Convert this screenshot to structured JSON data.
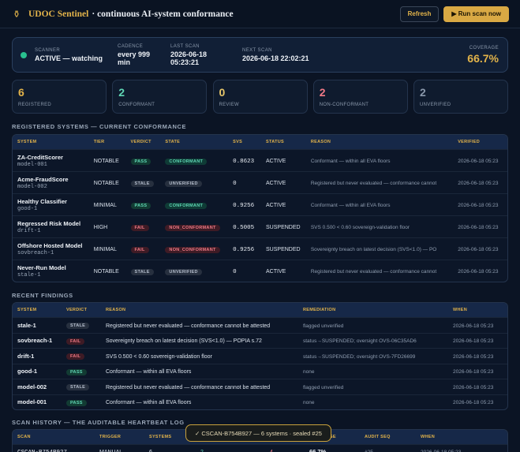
{
  "header": {
    "logo_icon": "shield-icon",
    "brand": "UDOC Sentinel",
    "tagline": "· continuous AI-system conformance",
    "refresh_label": "Refresh",
    "run_label": "▶ Run scan now"
  },
  "status": {
    "scanner_label": "SCANNER",
    "scanner_value": "ACTIVE — watching",
    "cadence_label": "CADENCE",
    "cadence_value": "every 999 min",
    "last_label": "LAST SCAN",
    "last_value": "2026-06-18 05:23:21",
    "next_label": "NEXT SCAN",
    "next_value": "2026-06-18 22:02:21",
    "coverage_label": "COVERAGE",
    "coverage_value": "66.7%"
  },
  "stats": [
    {
      "value": "6",
      "label": "REGISTERED",
      "color": "#e2b34a"
    },
    {
      "value": "2",
      "label": "CONFORMANT",
      "color": "#5fd6b4"
    },
    {
      "value": "0",
      "label": "REVIEW",
      "color": "#e8c76a"
    },
    {
      "value": "2",
      "label": "NON-CONFORMANT",
      "color": "#f07a86"
    },
    {
      "value": "2",
      "label": "UNVERIFIED",
      "color": "#8a98ab"
    }
  ],
  "systems": {
    "title": "REGISTERED SYSTEMS — CURRENT CONFORMANCE",
    "headers": [
      "SYSTEM",
      "TIER",
      "VERDICT",
      "STATE",
      "SVS",
      "STATUS",
      "REASON",
      "VERIFIED"
    ],
    "rows": [
      {
        "name": "ZA-CreditScorer",
        "id": "model-001",
        "tier": "NOTABLE",
        "verdict": "PASS",
        "state": "CONFORMANT",
        "svs": "0.8623",
        "status": "ACTIVE",
        "reason": "Conformant — within all EVA floors",
        "verified": "2026-06-18 05:23"
      },
      {
        "name": "Acme-FraudScore",
        "id": "model-002",
        "tier": "NOTABLE",
        "verdict": "STALE",
        "state": "UNVERIFIED",
        "svs": "0",
        "status": "ACTIVE",
        "reason": "Registered but never evaluated — conformance cannot",
        "verified": "2026-06-18 05:23"
      },
      {
        "name": "Healthy Classifier",
        "id": "good-1",
        "tier": "MINIMAL",
        "verdict": "PASS",
        "state": "CONFORMANT",
        "svs": "0.9256",
        "status": "ACTIVE",
        "reason": "Conformant — within all EVA floors",
        "verified": "2026-06-18 05:23"
      },
      {
        "name": "Regressed Risk Model",
        "id": "drift-1",
        "tier": "HIGH",
        "verdict": "FAIL",
        "state": "NON_CONFORMANT",
        "svs": "0.5005",
        "status": "SUSPENDED",
        "reason": "SVS 0.500 < 0.60 sovereign-validation floor",
        "verified": "2026-06-18 05:23"
      },
      {
        "name": "Offshore Hosted Model",
        "id": "sovbreach-1",
        "tier": "MINIMAL",
        "verdict": "FAIL",
        "state": "NON_CONFORMANT",
        "svs": "0.9256",
        "status": "SUSPENDED",
        "reason": "Sovereignty breach on latest decision (SVS<1.0) — PO",
        "verified": "2026-06-18 05:23"
      },
      {
        "name": "Never-Run Model",
        "id": "stale-1",
        "tier": "NOTABLE",
        "verdict": "STALE",
        "state": "UNVERIFIED",
        "svs": "0",
        "status": "ACTIVE",
        "reason": "Registered but never evaluated — conformance cannot",
        "verified": "2026-06-18 05:23"
      }
    ]
  },
  "findings": {
    "title": "RECENT FINDINGS",
    "headers": [
      "SYSTEM",
      "VERDICT",
      "REASON",
      "REMEDIATION",
      "WHEN"
    ],
    "rows": [
      {
        "system": "stale-1",
        "verdict": "STALE",
        "reason": "Registered but never evaluated — conformance cannot be attested",
        "remediation": "flagged unverified",
        "when": "2026-06-18 05:23"
      },
      {
        "system": "sovbreach-1",
        "verdict": "FAIL",
        "reason": "Sovereignty breach on latest decision (SVS<1.0) — POPIA s.72",
        "remediation": "status→SUSPENDED; oversight OVS-06C35AD6",
        "when": "2026-06-18 05:23"
      },
      {
        "system": "drift-1",
        "verdict": "FAIL",
        "reason": "SVS 0.500 < 0.60 sovereign-validation floor",
        "remediation": "status→SUSPENDED; oversight OVS-7FD26699",
        "when": "2026-06-18 05:23"
      },
      {
        "system": "good-1",
        "verdict": "PASS",
        "reason": "Conformant — within all EVA floors",
        "remediation": "none",
        "when": "2026-06-18 05:23"
      },
      {
        "system": "model-002",
        "verdict": "STALE",
        "reason": "Registered but never evaluated — conformance cannot be attested",
        "remediation": "flagged unverified",
        "when": "2026-06-18 05:23"
      },
      {
        "system": "model-001",
        "verdict": "PASS",
        "reason": "Conformant — within all EVA floors",
        "remediation": "none",
        "when": "2026-06-18 05:23"
      }
    ]
  },
  "history": {
    "title": "SCAN HISTORY — THE AUDITABLE HEARTBEAT LOG",
    "headers": [
      "SCAN",
      "TRIGGER",
      "SYSTEMS",
      "",
      "",
      "COVERAGE",
      "AUDIT SEQ",
      "WHEN"
    ],
    "rows": [
      {
        "scan": "CSCAN-B754B927",
        "trigger": "MANUAL",
        "systems": "6",
        "pass": "2",
        "fail": "4",
        "coverage": "66.7%",
        "seq": "#25",
        "when": "2026-06-18 05:23"
      }
    ]
  },
  "toast": "✓ CSCAN-B754B927 — 6 systems · sealed #25",
  "colors": {
    "gold": "#e2b34a",
    "pass": "#5fd6b4",
    "fail": "#f07a86",
    "bg": "#0b1424"
  }
}
